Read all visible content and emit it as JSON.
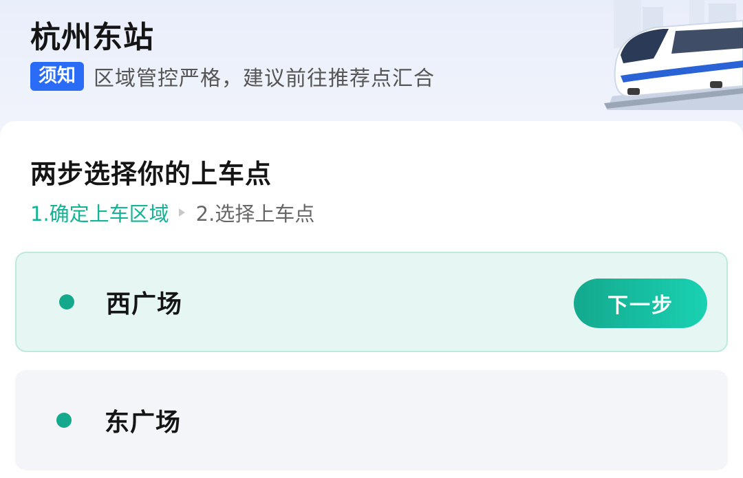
{
  "header": {
    "station_title": "杭州东站",
    "notice_badge": "须知",
    "notice_text": "区域管控严格，建议前往推荐点汇合"
  },
  "main": {
    "steps_title": "两步选择你的上车点",
    "steps": [
      {
        "label": "1.确定上车区域",
        "active": true
      },
      {
        "label": "2.选择上车点",
        "active": false
      }
    ],
    "options": [
      {
        "label": "西广场",
        "selected": true
      },
      {
        "label": "东广场",
        "selected": false
      }
    ],
    "next_button_label": "下一步"
  },
  "colors": {
    "accent": "#14b394",
    "notice_badge": "#2a6cf6",
    "selected_option_bg": "#e6f7f3"
  },
  "icons": [
    "train-illustration-icon",
    "step-arrow-icon",
    "option-dot-icon"
  ]
}
